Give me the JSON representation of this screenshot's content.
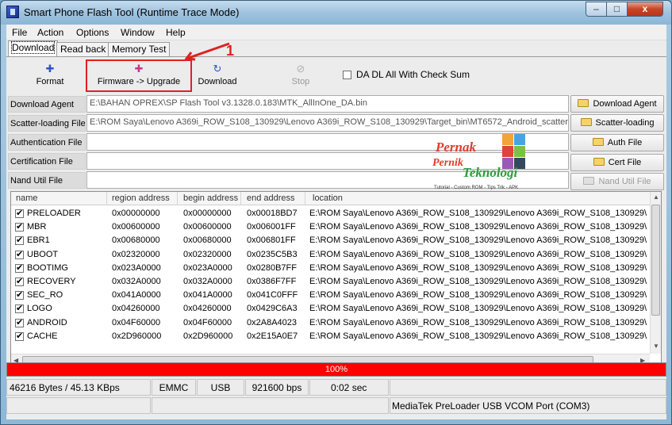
{
  "window": {
    "title": "Smart Phone Flash Tool (Runtime Trace Mode)",
    "controls": {
      "minimize": "–",
      "maximize": "□",
      "close": "x"
    }
  },
  "menu": [
    "File",
    "Action",
    "Options",
    "Window",
    "Help"
  ],
  "tabs": [
    "Download",
    "Read back",
    "Memory Test"
  ],
  "annotation": {
    "number": "1",
    "color": "#e02020"
  },
  "toolbar": {
    "format": "Format",
    "firmware_upgrade": "Firmware -> Upgrade",
    "download": "Download",
    "stop": "Stop",
    "checksum": "DA DL All With Check Sum",
    "checksum_checked": false
  },
  "fields": {
    "download_agent": {
      "label": "Download Agent",
      "value": "E:\\BAHAN OPREX\\SP Flash Tool v3.1328.0.183\\MTK_AllInOne_DA.bin",
      "button": "Download Agent"
    },
    "scatter": {
      "label": "Scatter-loading File",
      "value": "E:\\ROM Saya\\Lenovo A369i_ROW_S108_130929\\Lenovo A369i_ROW_S108_130929\\Target_bin\\MT6572_Android_scatter",
      "button": "Scatter-loading"
    },
    "auth": {
      "label": "Authentication File",
      "value": "",
      "button": "Auth File"
    },
    "cert": {
      "label": "Certification File",
      "value": "",
      "button": "Cert File"
    },
    "nand": {
      "label": "Nand Util File",
      "value": "",
      "button": "Nand Util File"
    }
  },
  "watermark": {
    "line1": "Pernak",
    "line2": "Pernik",
    "line3": "Teknologi",
    "tagline": "Tutorial - Custom ROM - Tips Trik - APK"
  },
  "table": {
    "columns": [
      "name",
      "region address",
      "begin address",
      "end address",
      "location"
    ],
    "rows": [
      {
        "name": "PRELOADER",
        "region": "0x00000000",
        "begin": "0x00000000",
        "end": "0x00018BD7",
        "location": "E:\\ROM Saya\\Lenovo A369i_ROW_S108_130929\\Lenovo A369i_ROW_S108_130929\\"
      },
      {
        "name": "MBR",
        "region": "0x00600000",
        "begin": "0x00600000",
        "end": "0x006001FF",
        "location": "E:\\ROM Saya\\Lenovo A369i_ROW_S108_130929\\Lenovo A369i_ROW_S108_130929\\"
      },
      {
        "name": "EBR1",
        "region": "0x00680000",
        "begin": "0x00680000",
        "end": "0x006801FF",
        "location": "E:\\ROM Saya\\Lenovo A369i_ROW_S108_130929\\Lenovo A369i_ROW_S108_130929\\"
      },
      {
        "name": "UBOOT",
        "region": "0x02320000",
        "begin": "0x02320000",
        "end": "0x0235C5B3",
        "location": "E:\\ROM Saya\\Lenovo A369i_ROW_S108_130929\\Lenovo A369i_ROW_S108_130929\\"
      },
      {
        "name": "BOOTIMG",
        "region": "0x023A0000",
        "begin": "0x023A0000",
        "end": "0x0280B7FF",
        "location": "E:\\ROM Saya\\Lenovo A369i_ROW_S108_130929\\Lenovo A369i_ROW_S108_130929\\"
      },
      {
        "name": "RECOVERY",
        "region": "0x032A0000",
        "begin": "0x032A0000",
        "end": "0x0386F7FF",
        "location": "E:\\ROM Saya\\Lenovo A369i_ROW_S108_130929\\Lenovo A369i_ROW_S108_130929\\"
      },
      {
        "name": "SEC_RO",
        "region": "0x041A0000",
        "begin": "0x041A0000",
        "end": "0x041C0FFF",
        "location": "E:\\ROM Saya\\Lenovo A369i_ROW_S108_130929\\Lenovo A369i_ROW_S108_130929\\"
      },
      {
        "name": "LOGO",
        "region": "0x04260000",
        "begin": "0x04260000",
        "end": "0x0429C6A3",
        "location": "E:\\ROM Saya\\Lenovo A369i_ROW_S108_130929\\Lenovo A369i_ROW_S108_130929\\"
      },
      {
        "name": "ANDROID",
        "region": "0x04F60000",
        "begin": "0x04F60000",
        "end": "0x2A8A4023",
        "location": "E:\\ROM Saya\\Lenovo A369i_ROW_S108_130929\\Lenovo A369i_ROW_S108_130929\\"
      },
      {
        "name": "CACHE",
        "region": "0x2D960000",
        "begin": "0x2D960000",
        "end": "0x2E15A0E7",
        "location": "E:\\ROM Saya\\Lenovo A369i_ROW_S108_130929\\Lenovo A369i_ROW_S108_130929\\"
      }
    ]
  },
  "progress": {
    "text": "100%",
    "percent": 100,
    "color": "#ff0000"
  },
  "status": {
    "speed": "46216 Bytes / 45.13 KBps",
    "storage": "EMMC",
    "interface": "USB",
    "baud": "921600 bps",
    "time": "0:02 sec",
    "port": "MediaTek PreLoader USB VCOM Port (COM3)"
  }
}
